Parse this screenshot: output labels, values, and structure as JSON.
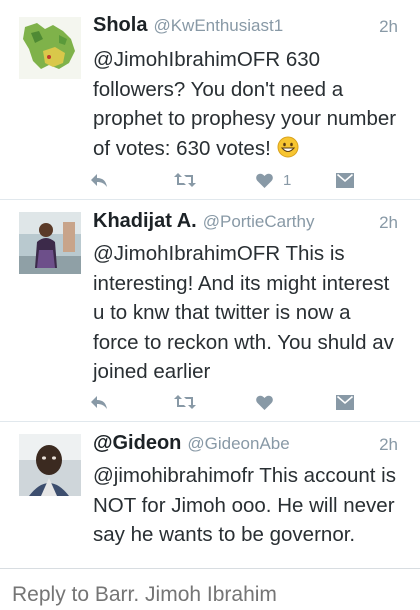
{
  "tweets": [
    {
      "name": "Shola",
      "handle": "@KwEnthusiast1",
      "time": "2h",
      "text": "@JimohIbrahimOFR 630 followers? You don't need a prophet to prophesy your number of votes: 630 votes!",
      "emoji": "grinning-face-emoji",
      "favorite_count": "1",
      "avatar": "map-of-ondo-state"
    },
    {
      "name": "Khadijat A.",
      "handle": "@PortieCarthy",
      "time": "2h",
      "text": "@JimohIbrahimOFR This is interesting! And its might interest u to knw that twitter is now a force to reckon wth. You shuld av joined earlier",
      "favorite_count": "",
      "avatar": "woman-photo"
    },
    {
      "name": "@Gideon",
      "handle": "@GideonAbe",
      "time": "2h",
      "text": "@jimohibrahimofr This account is NOT for Jimoh ooo. He will never say he wants to be governor.",
      "avatar": "man-photo"
    }
  ],
  "reply": {
    "placeholder": "Reply to Barr. Jimoh Ibrahim"
  },
  "colors": {
    "text": "#292f33",
    "secondary": "#8899a6",
    "icon": "#8899a6",
    "divider": "#e1e8ed"
  }
}
